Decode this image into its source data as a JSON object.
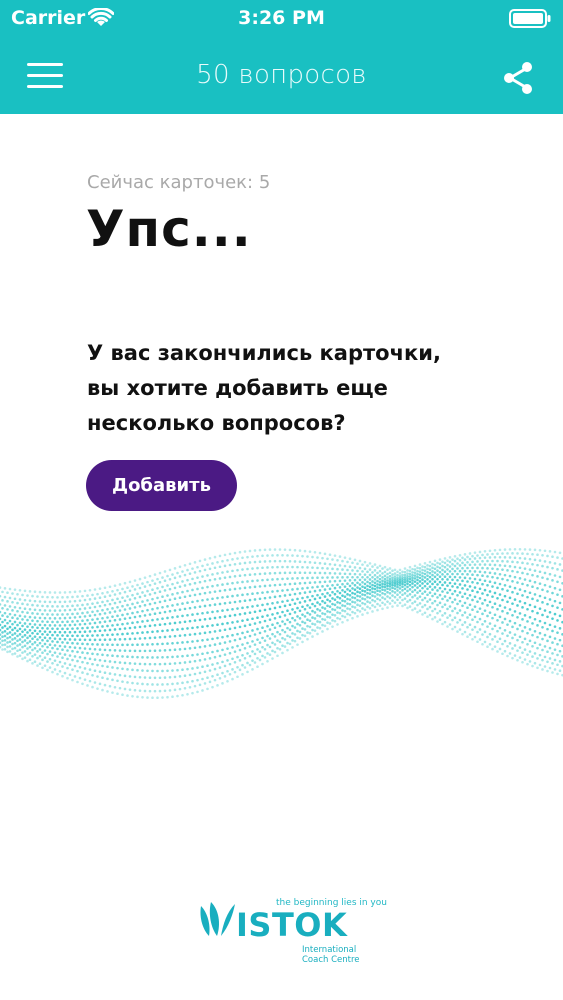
{
  "status_bar": {
    "carrier": "Carrier",
    "time": "3:26 PM"
  },
  "nav": {
    "title": "50 вопросов"
  },
  "content": {
    "count_label": "Сейчас карточек: 5",
    "headline": "Упс...",
    "message_lines": [
      "У вас закончились карточки,",
      "вы хотите добавить еще",
      "несколько вопросов?"
    ],
    "add_button": "Добавить"
  },
  "logo": {
    "tagline": "the beginning lies in you",
    "brand": "ISTOK",
    "sub_line1": "International",
    "sub_line2": "Coach Centre"
  },
  "colors": {
    "header": "#19c0c2",
    "button": "#4b1a84",
    "wave": "#2bc3c6",
    "muted_text": "#a9a9a9"
  },
  "icons": [
    "wifi-icon",
    "battery-icon",
    "hamburger-menu-icon",
    "share-icon",
    "istok-leaf-logo-icon"
  ]
}
